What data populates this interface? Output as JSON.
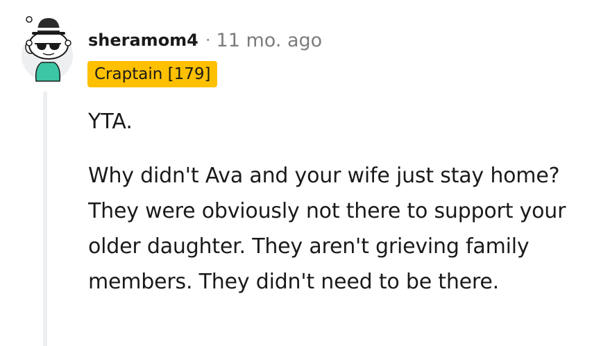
{
  "comment": {
    "author": "sheramom4",
    "separator": "·",
    "timestamp": "11 mo. ago",
    "flair": "Craptain [179]",
    "avatar_icon": "snoo-avatar-icon",
    "paragraphs": [
      "YTA.",
      "Why didn't Ava and your wife just stay home? They were obviously not there to support your older daughter. They aren't grieving family members. They didn't need to be there."
    ]
  },
  "colors": {
    "flair_background": "#ffc000",
    "thread_line": "#edeff1",
    "username": "#1a1a1b",
    "timestamp": "#7c7c7c"
  }
}
